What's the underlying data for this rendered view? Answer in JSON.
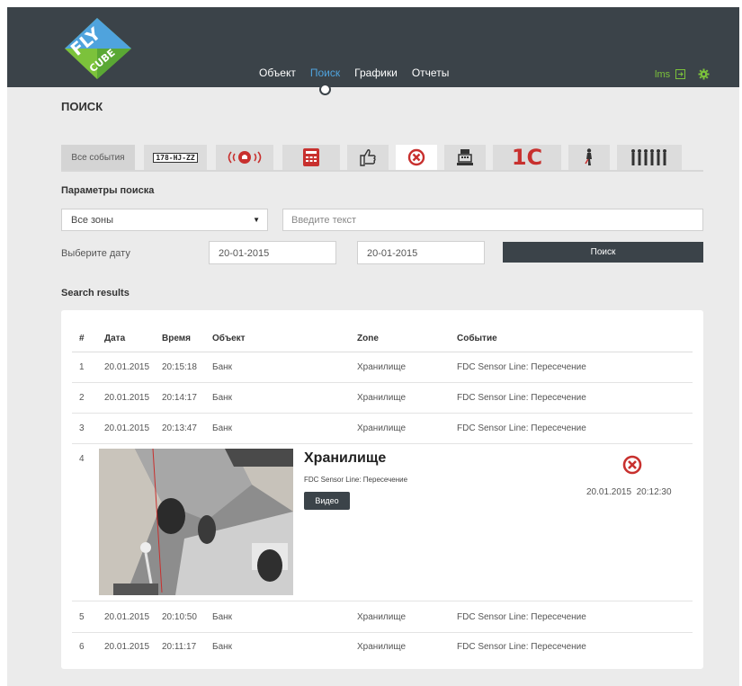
{
  "colors": {
    "topbar": "#3b4349",
    "accent": "#4fa3dd",
    "user_green": "#7cc23b",
    "alarm_red": "#c8302e"
  },
  "logo": {
    "text_fly": "FLY",
    "text_cube": "CUBE"
  },
  "nav": {
    "items": [
      "Объект",
      "Поиск",
      "Графики",
      "Отчеты"
    ],
    "active": "Поиск"
  },
  "user": {
    "name": "lms",
    "logout_icon": "logout-icon",
    "settings_icon": "gear-icon"
  },
  "page_title": "ПОИСК",
  "tabs": {
    "all_events": "Все события",
    "plate": "178-HJ-ZZ",
    "one_c": "1C",
    "icons": [
      "license-plate-icon",
      "alarm-icon",
      "calculator-icon",
      "hand-icon",
      "no-entry-icon",
      "cash-register-icon",
      "1c-icon",
      "person-icon",
      "people-icon"
    ]
  },
  "params": {
    "title": "Параметры поиска",
    "zone_select": "Все зоны",
    "text_placeholder": "Введите текст",
    "date_label": "Выберите дату",
    "date_from": "20-01-2015",
    "date_to": "20-01-2015",
    "search_button": "Поиск"
  },
  "results": {
    "title": "Search results",
    "headers": {
      "num": "#",
      "date": "Дата",
      "time": "Время",
      "object": "Объект",
      "zone": "Zone",
      "event": "Событие"
    },
    "rows": [
      {
        "num": "1",
        "date": "20.01.2015",
        "time": "20:15:18",
        "object": "Банк",
        "zone": "Хранилище",
        "event": "FDC Sensor Line: Пересечение"
      },
      {
        "num": "2",
        "date": "20.01.2015",
        "time": "20:14:17",
        "object": "Банк",
        "zone": "Хранилище",
        "event": "FDC Sensor Line: Пересечение"
      },
      {
        "num": "3",
        "date": "20.01.2015",
        "time": "20:13:47",
        "object": "Банк",
        "zone": "Хранилище",
        "event": "FDC Sensor Line: Пересечение"
      },
      {
        "num": "5",
        "date": "20.01.2015",
        "time": "20:10:50",
        "object": "Банк",
        "zone": "Хранилище",
        "event": "FDC Sensor Line: Пересечение"
      },
      {
        "num": "6",
        "date": "20.01.2015",
        "time": "20:11:17",
        "object": "Банк",
        "zone": "Хранилище",
        "event": "FDC Sensor Line: Пересечение"
      }
    ],
    "expanded": {
      "num": "4",
      "zone": "Хранилище",
      "event": "FDC Sensor Line: Пересечение",
      "video_button": "Видео",
      "datetime": "20.01.2015  20:12:30",
      "icon": "no-entry-icon"
    }
  }
}
